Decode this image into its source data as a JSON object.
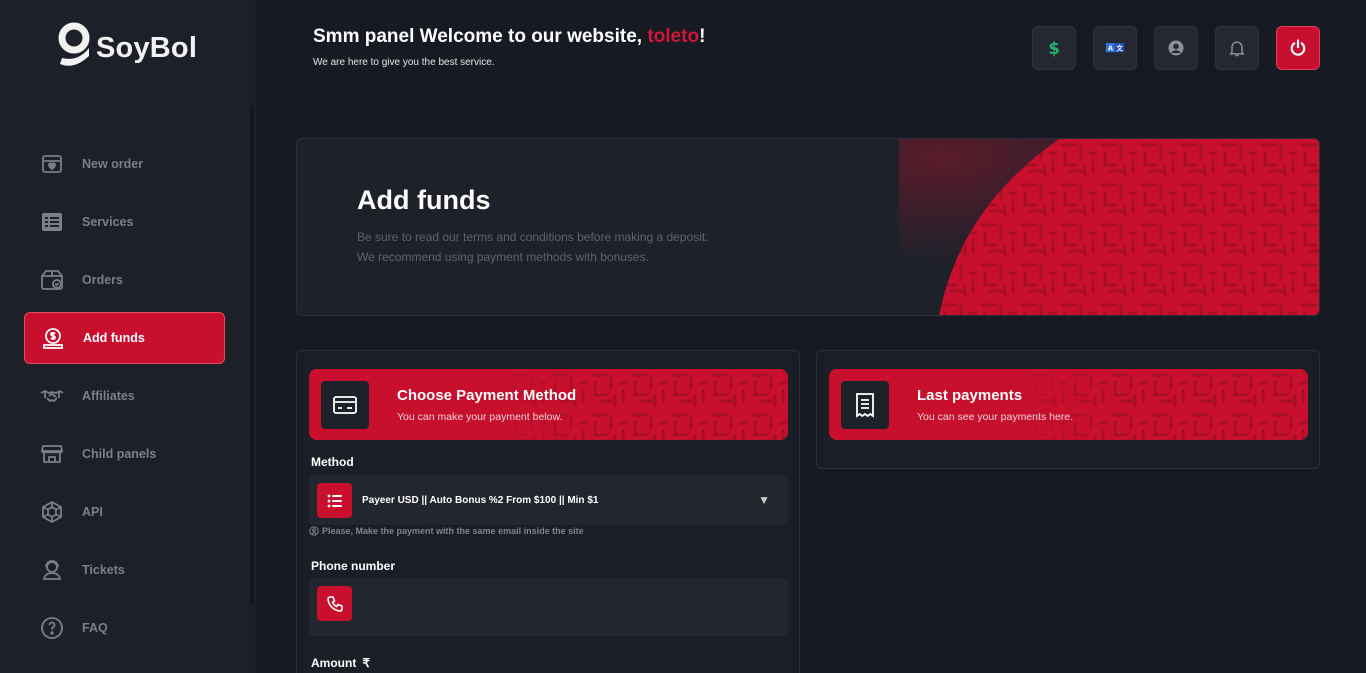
{
  "brand": {
    "name": "SoyBol",
    "accent": "#c8102e"
  },
  "sidebar": {
    "items": [
      {
        "label": "New order",
        "icon": "new-order-icon",
        "active": false
      },
      {
        "label": "Services",
        "icon": "services-list-icon",
        "active": false
      },
      {
        "label": "Orders",
        "icon": "orders-box-icon",
        "active": false
      },
      {
        "label": "Add funds",
        "icon": "add-funds-icon",
        "active": true
      },
      {
        "label": "Affiliates",
        "icon": "handshake-icon",
        "active": false
      },
      {
        "label": "Child panels",
        "icon": "store-icon",
        "active": false
      },
      {
        "label": "API",
        "icon": "api-icon",
        "active": false
      },
      {
        "label": "Tickets",
        "icon": "support-icon",
        "active": false
      },
      {
        "label": "FAQ",
        "icon": "question-icon",
        "active": false
      }
    ]
  },
  "header": {
    "welcome_prefix": "Smm panel Welcome to our website, ",
    "username": "toleto",
    "welcome_suffix": "!",
    "subtitle": "We are here to give you the best service.",
    "buttons": [
      "dollar-icon",
      "translate-icon",
      "user-icon",
      "bell-icon",
      "power-icon"
    ]
  },
  "banner": {
    "title": "Add funds",
    "line1": "Be sure to read our terms and conditions before making a deposit.",
    "line2": "We recommend using payment methods with bonuses."
  },
  "payment_card": {
    "title": "Choose Payment Method",
    "subtitle": "You can make your payment below.",
    "method_label": "Method",
    "method_value": "Payeer USD || Auto Bonus %2 From $100 || Min $1",
    "note": "Please, Make the payment with the same email inside the site",
    "phone_label": "Phone number",
    "phone_value": "",
    "amount_label": "Amount",
    "currency_symbol": "₹"
  },
  "last_payments_card": {
    "title": "Last payments",
    "subtitle": "You can see your payments here."
  }
}
